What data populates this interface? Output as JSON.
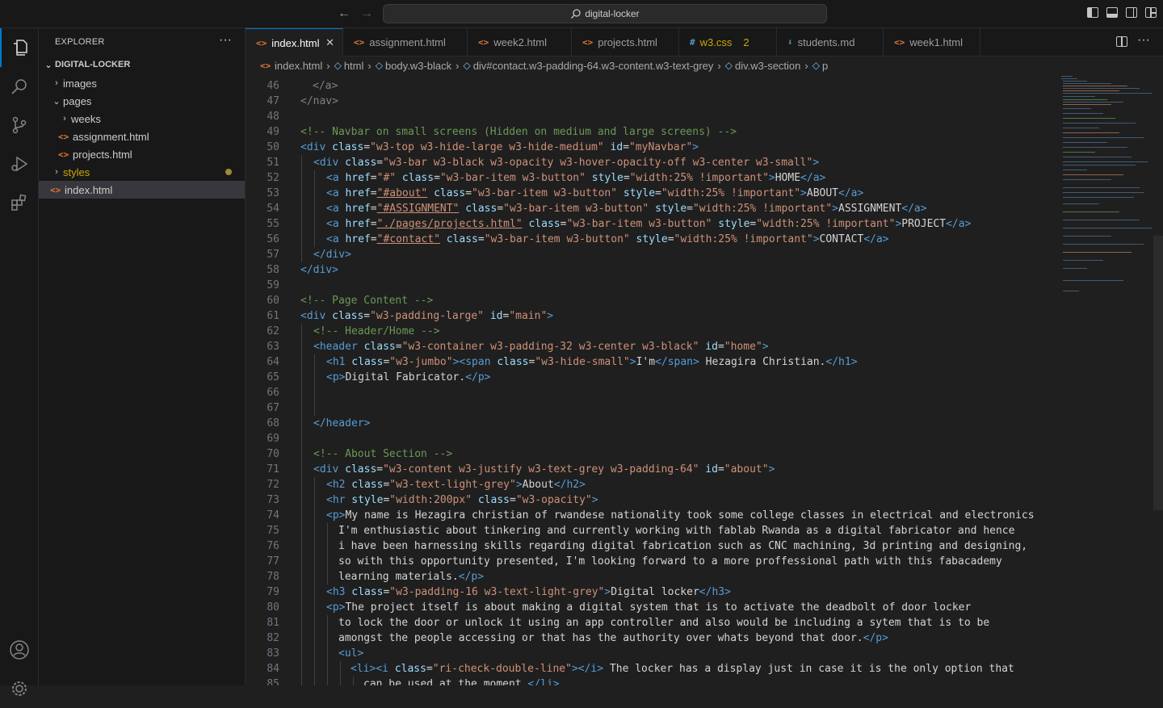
{
  "titlebar": {
    "search_text": "digital-locker"
  },
  "explorer": {
    "title": "EXPLORER",
    "root": "DIGITAL-LOCKER",
    "items": [
      {
        "label": "images"
      },
      {
        "label": "pages"
      },
      {
        "label": "weeks"
      },
      {
        "label": "assignment.html"
      },
      {
        "label": "projects.html"
      },
      {
        "label": "styles"
      },
      {
        "label": "index.html"
      }
    ]
  },
  "tabs": [
    {
      "label": "index.html",
      "icon": "html-icon"
    },
    {
      "label": "assignment.html",
      "icon": "html-icon"
    },
    {
      "label": "week2.html",
      "icon": "html-icon"
    },
    {
      "label": "projects.html",
      "icon": "html-icon"
    },
    {
      "label": "w3.css",
      "icon": "css-icon",
      "badge": "2"
    },
    {
      "label": "students.md",
      "icon": "markdown-icon"
    },
    {
      "label": "week1.html",
      "icon": "html-icon"
    }
  ],
  "breadcrumb": [
    "index.html",
    "html",
    "body.w3-black",
    "div#contact.w3-padding-64.w3-content.w3-text-grey",
    "div.w3-section",
    "p"
  ],
  "line_numbers": [
    "46",
    "47",
    "48",
    "49",
    "50",
    "51",
    "52",
    "53",
    "54",
    "55",
    "56",
    "57",
    "58",
    "59",
    "60",
    "61",
    "62",
    "63",
    "64",
    "65",
    "66",
    "67",
    "68",
    "69",
    "70",
    "71",
    "72",
    "73",
    "74",
    "75",
    "76",
    "77",
    "78",
    "79",
    "80",
    "81",
    "82",
    "83",
    "84",
    "85"
  ],
  "code": {
    "l46_a": "</a>",
    "l47_a": "</nav>",
    "l49_cm": "<!-- Navbar on small screens (Hidden on medium and large screens) -->",
    "l50_a": "<div",
    "l50_b": " class",
    "l50_c": "=",
    "l50_d": "\"w3-top w3-hide-large w3-hide-medium\"",
    "l50_e": " id",
    "l50_f": "=",
    "l50_g": "\"myNavbar\"",
    "l50_h": ">",
    "l51_a": "<div",
    "l51_b": " class",
    "l51_c": "=",
    "l51_d": "\"w3-bar w3-black w3-opacity w3-hover-opacity-off w3-center w3-small\"",
    "l51_h": ">",
    "l52_a": "<a",
    "l52_b": " href",
    "l52_c": "=",
    "l52_d": "\"#\"",
    "l52_e": " class",
    "l52_f": "=",
    "l52_g": "\"w3-bar-item w3-button\"",
    "l52_i": " style",
    "l52_j": "=",
    "l52_k": "\"width:25% !important\"",
    "l52_l": ">",
    "l52_m": "HOME",
    "l52_n": "</a>",
    "l53_a": "<a",
    "l53_b": " href",
    "l53_c": "=",
    "l53_d": "\"#about\"",
    "l53_e": " class",
    "l53_f": "=",
    "l53_g": "\"w3-bar-item w3-button\"",
    "l53_i": " style",
    "l53_j": "=",
    "l53_k": "\"width:25% !important\"",
    "l53_l": ">",
    "l53_m": "ABOUT",
    "l53_n": "</a>",
    "l54_a": "<a",
    "l54_b": " href",
    "l54_c": "=",
    "l54_d": "\"#ASSIGNMENT\"",
    "l54_e": " class",
    "l54_f": "=",
    "l54_g": "\"w3-bar-item w3-button\"",
    "l54_i": " style",
    "l54_j": "=",
    "l54_k": "\"width:25% !important\"",
    "l54_l": ">",
    "l54_m": "ASSIGNMENT",
    "l54_n": "</a>",
    "l55_a": "<a",
    "l55_b": " href",
    "l55_c": "=",
    "l55_d": "\"./pages/projects.html\"",
    "l55_e": " class",
    "l55_f": "=",
    "l55_g": "\"w3-bar-item w3-button\"",
    "l55_i": " style",
    "l55_j": "=",
    "l55_k": "\"width:25% !important\"",
    "l55_l": ">",
    "l55_m": "PROJECT",
    "l55_n": "</a>",
    "l56_a": "<a",
    "l56_b": " href",
    "l56_c": "=",
    "l56_d": "\"#contact\"",
    "l56_e": " class",
    "l56_f": "=",
    "l56_g": "\"w3-bar-item w3-button\"",
    "l56_i": " style",
    "l56_j": "=",
    "l56_k": "\"width:25% !important\"",
    "l56_l": ">",
    "l56_m": "CONTACT",
    "l56_n": "</a>",
    "l57_a": "</div>",
    "l58_a": "</div>",
    "l60_cm": "<!-- Page Content -->",
    "l61_a": "<div",
    "l61_b": " class",
    "l61_c": "=",
    "l61_d": "\"w3-padding-large\"",
    "l61_e": " id",
    "l61_f": "=",
    "l61_g": "\"main\"",
    "l61_h": ">",
    "l62_cm": "<!-- Header/Home -->",
    "l63_a": "<header",
    "l63_b": " class",
    "l63_c": "=",
    "l63_d": "\"w3-container w3-padding-32 w3-center w3-black\"",
    "l63_e": " id",
    "l63_f": "=",
    "l63_g": "\"home\"",
    "l63_h": ">",
    "l64_a": "<h1",
    "l64_b": " class",
    "l64_c": "=",
    "l64_d": "\"w3-jumbo\"",
    "l64_e": ">",
    "l64_f": "<span",
    "l64_g": " class",
    "l64_h": "=",
    "l64_i": "\"w3-hide-small\"",
    "l64_j": ">",
    "l64_k": "I'm",
    "l64_l": "</span>",
    "l64_m": " Hezagira Christian.",
    "l64_n": "</h1>",
    "l65_a": "<p>",
    "l65_b": "Digital Fabricator.",
    "l65_c": "</p>",
    "l68_a": "</header>",
    "l70_cm": "<!-- About Section -->",
    "l71_a": "<div",
    "l71_b": " class",
    "l71_c": "=",
    "l71_d": "\"w3-content w3-justify w3-text-grey w3-padding-64\"",
    "l71_e": " id",
    "l71_f": "=",
    "l71_g": "\"about\"",
    "l71_h": ">",
    "l72_a": "<h2",
    "l72_b": " class",
    "l72_c": "=",
    "l72_d": "\"w3-text-light-grey\"",
    "l72_e": ">",
    "l72_f": "About",
    "l72_g": "</h2>",
    "l73_a": "<hr",
    "l73_b": " style",
    "l73_c": "=",
    "l73_d": "\"width:200px\"",
    "l73_e": " class",
    "l73_f": "=",
    "l73_g": "\"w3-opacity\"",
    "l73_h": ">",
    "l74_a": "<p>",
    "l74_b": "My name is Hezagira christian of rwandese nationality took some college classes in electrical and electronics",
    "l75_a": "I'm enthusiastic about tinkering and currently working with fablab Rwanda as a digital fabricator and hence",
    "l76_a": "i have been harnessing skills regarding digital fabrication such as CNC machining, 3d printing and designing,",
    "l77_a": "so with this opportunity presented, I'm looking forward to a more proffessional path with this fabacademy",
    "l78_a": "learning materials.",
    "l78_b": "</p>",
    "l79_a": "<h3",
    "l79_b": " class",
    "l79_c": "=",
    "l79_d": "\"w3-padding-16 w3-text-light-grey\"",
    "l79_e": ">",
    "l79_f": "Digital locker",
    "l79_g": "</h3>",
    "l80_a": "<p>",
    "l80_b": "The project itself is about making a digital system that is to activate the deadbolt of door locker",
    "l81_a": "to lock the door or unlock it using an app controller and also would be including a sytem that is to be",
    "l82_a": "amongst the people accessing or that has the authority over whats beyond that door.",
    "l82_b": "</p>",
    "l83_a": "<ul>",
    "l84_a": "<li>",
    "l84_b": "<i",
    "l84_c": " class",
    "l84_d": "=",
    "l84_e": "\"ri-check-double-line\"",
    "l84_f": ">",
    "l84_g": "</i>",
    "l84_h": " The locker has a display just in case it is the only option that",
    "l85_a": "can be used at the moment.",
    "l85_b": "</li>"
  },
  "colors": {
    "accent": "#0078d4",
    "tag": "#569cd6",
    "attr": "#9cdcfe",
    "string": "#ce9178",
    "comment": "#6a9955",
    "modified": "#cca700"
  }
}
